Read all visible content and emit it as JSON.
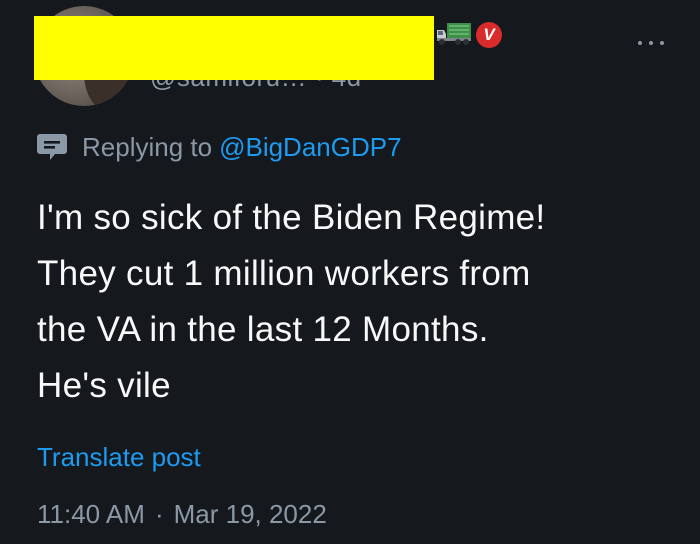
{
  "author": {
    "handle_partial": "@samiforu… · 4d"
  },
  "reply": {
    "prefix": "Replying to",
    "target": "@BigDanGDP7"
  },
  "post": {
    "text": "I'm so sick of the Biden Regime!\nThey cut 1 million workers from\nthe VA in the last 12 Months.\nHe's vile"
  },
  "translate_label": "Translate post",
  "meta": {
    "time": "11:40 AM",
    "separator": "·",
    "date": "Mar 19, 2022"
  },
  "icons": {
    "badge_letter": "V",
    "badge_color": "#d92b2b",
    "link_color": "#1d9bf0",
    "highlight_color": "#ffff00"
  }
}
